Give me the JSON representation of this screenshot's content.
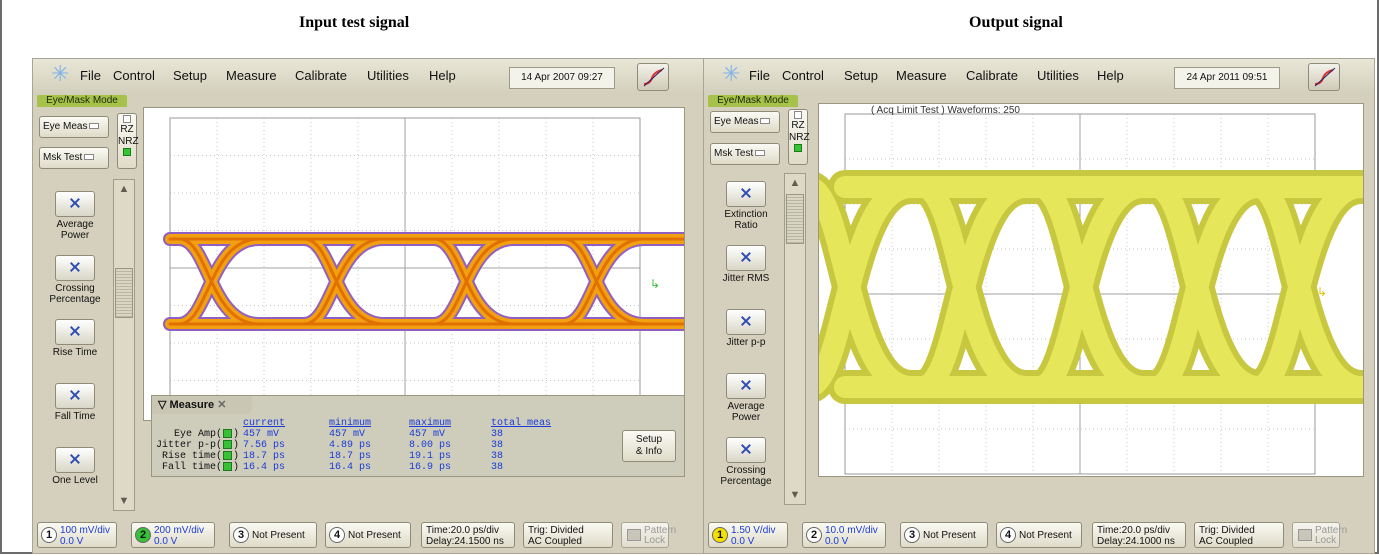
{
  "captions": {
    "left": "Input test signal",
    "right": "Output signal"
  },
  "left": {
    "menu": [
      "File",
      "Control",
      "Setup",
      "Measure",
      "Calibrate",
      "Utilities",
      "Help"
    ],
    "date": "14 Apr 2007  09:27",
    "mode": "Eye/Mask Mode",
    "eye_meas": "Eye Meas",
    "msk_test": "Msk Test",
    "rz": "RZ",
    "nrz": "NRZ",
    "tools": [
      {
        "icon": "average-power-icon",
        "label1": "Average",
        "label2": "Power"
      },
      {
        "icon": "crossing-percentage-icon",
        "label1": "Crossing",
        "label2": "Percentage"
      },
      {
        "icon": "rise-time-icon",
        "label1": "Rise Time",
        "label2": ""
      },
      {
        "icon": "fall-time-icon",
        "label1": "Fall Time",
        "label2": ""
      },
      {
        "icon": "one-level-icon",
        "label1": "One Level",
        "label2": ""
      }
    ],
    "measure": {
      "title": "Measure",
      "headers": [
        "current",
        "minimum",
        "maximum",
        "total meas"
      ],
      "rows": [
        {
          "label": "Eye Amp(",
          "current": "457 mV",
          "minimum": "457 mV",
          "maximum": "457 mV",
          "total": "38"
        },
        {
          "label": "Jitter p-p(",
          "current": "7.56 ps",
          "minimum": "4.89 ps",
          "maximum": "8.00 ps",
          "total": "38"
        },
        {
          "label": "Rise time(",
          "current": "18.7 ps",
          "minimum": "18.7 ps",
          "maximum": "19.1 ps",
          "total": "38"
        },
        {
          "label": "Fall time(",
          "current": "16.4 ps",
          "minimum": "16.4 ps",
          "maximum": "16.9 ps",
          "total": "38"
        }
      ],
      "setup": "Setup\n& Info"
    },
    "channels": [
      {
        "num": "1",
        "l1": "100 mV/div",
        "l2": "0.0 V",
        "color": "#ffffff"
      },
      {
        "num": "2",
        "l1": "200 mV/div",
        "l2": "0.0 V",
        "color": "#37c137"
      },
      {
        "num": "3",
        "l1": "Not Present",
        "l2": "",
        "color": "#ffffff"
      },
      {
        "num": "4",
        "l1": "Not Present",
        "l2": "",
        "color": "#ffffff"
      }
    ],
    "time": {
      "l1": "Time:20.0 ps/div",
      "l2": "Delay:24.1500 ns"
    },
    "trig": {
      "l1": "Trig: Divided",
      "l2": "AC Coupled"
    },
    "lock": {
      "l1": "Pattern",
      "l2": "Lock"
    }
  },
  "right": {
    "menu": [
      "File",
      "Control",
      "Setup",
      "Measure",
      "Calibrate",
      "Utilities",
      "Help"
    ],
    "date": "24 Apr 2011  09:51",
    "mode": "Eye/Mask Mode",
    "eye_meas": "Eye Meas",
    "msk_test": "Msk Test",
    "rz": "RZ",
    "nrz": "NRZ",
    "acq": "( Acq Limit Test )  Waveforms: 250",
    "tools": [
      {
        "icon": "extinction-ratio-icon",
        "label1": "Extinction",
        "label2": "Ratio"
      },
      {
        "icon": "jitter-rms-icon",
        "label1": "Jitter RMS",
        "label2": ""
      },
      {
        "icon": "jitter-pp-icon",
        "label1": "Jitter p-p",
        "label2": ""
      },
      {
        "icon": "average-power-icon",
        "label1": "Average",
        "label2": "Power"
      },
      {
        "icon": "crossing-percentage-icon",
        "label1": "Crossing",
        "label2": "Percentage"
      }
    ],
    "channels": [
      {
        "num": "1",
        "l1": "1.50 V/div",
        "l2": "0.0 V",
        "color": "#f4e000"
      },
      {
        "num": "2",
        "l1": "10.0 mV/div",
        "l2": "0.0 V",
        "color": "#ffffff"
      },
      {
        "num": "3",
        "l1": "Not Present",
        "l2": "",
        "color": "#ffffff"
      },
      {
        "num": "4",
        "l1": "Not Present",
        "l2": "",
        "color": "#ffffff"
      }
    ],
    "time": {
      "l1": "Time:20.0 ps/div",
      "l2": "Delay:24.1000 ns"
    },
    "trig": {
      "l1": "Trig: Divided",
      "l2": "AC Coupled"
    },
    "lock": {
      "l1": "Pattern",
      "l2": "Lock"
    }
  },
  "colors": {
    "left_trace": "#f2a010",
    "left_trace_core": "#e07000",
    "left_trace_edge": "#9060c0",
    "right_trace": "#e6e65a",
    "right_trace_edge": "#c8c840",
    "panel": "#d4d0bd",
    "value_blue": "#1a3bd8"
  }
}
